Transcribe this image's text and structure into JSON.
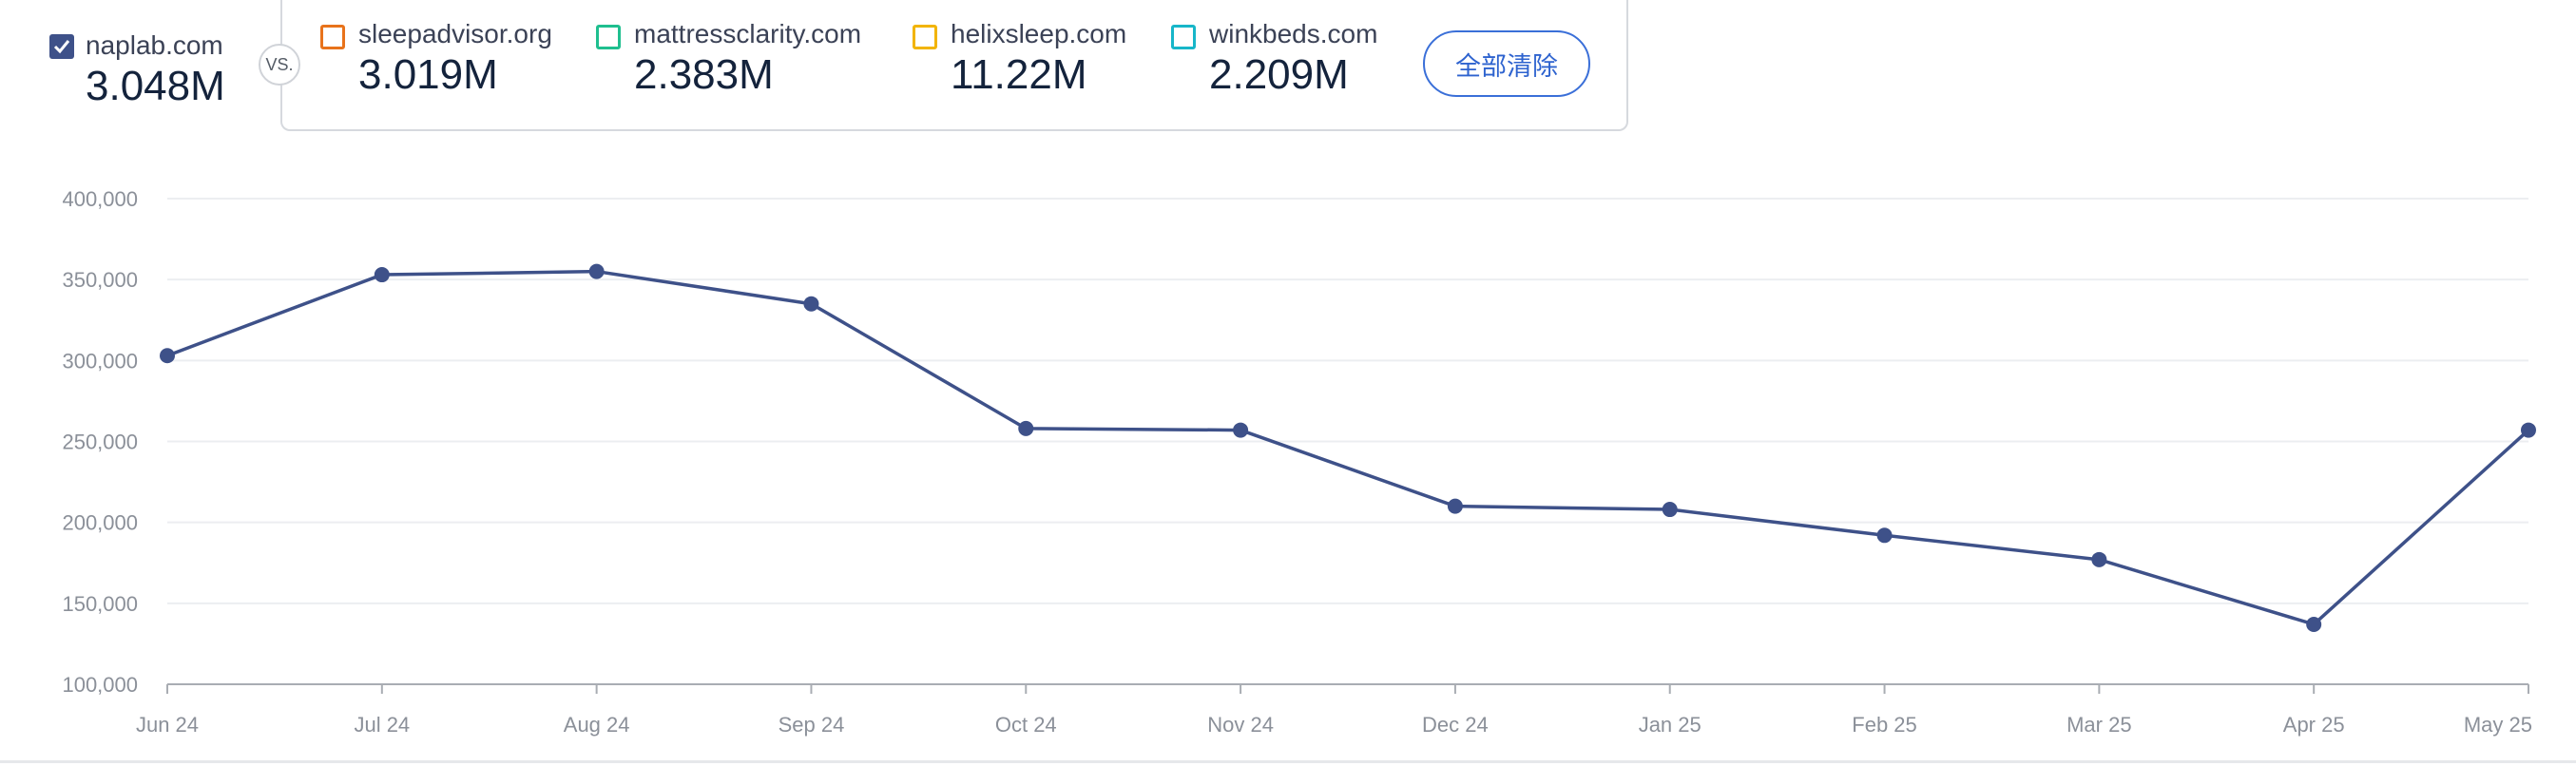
{
  "primary": {
    "domain": "naplab.com",
    "value": "3.048M",
    "checked": true,
    "color": "#3e5189"
  },
  "vs_label": "VS.",
  "competitors": [
    {
      "domain": "sleepadvisor.org",
      "value": "3.019M",
      "color": "#e8731b",
      "checked": false
    },
    {
      "domain": "mattressclarity.com",
      "value": "2.383M",
      "color": "#1fbf8f",
      "checked": false
    },
    {
      "domain": "helixsleep.com",
      "value": "11.22M",
      "color": "#f2b400",
      "checked": false
    },
    {
      "domain": "winkbeds.com",
      "value": "2.209M",
      "color": "#17b6c9",
      "checked": false
    }
  ],
  "clear_button_label": "全部清除",
  "chart_data": {
    "type": "line",
    "categories": [
      "Jun 24",
      "Jul 24",
      "Aug 24",
      "Sep 24",
      "Oct 24",
      "Nov 24",
      "Dec 24",
      "Jan 25",
      "Feb 25",
      "Mar 25",
      "Apr 25",
      "May 25"
    ],
    "series": [
      {
        "name": "naplab.com",
        "color": "#3e5189",
        "values": [
          303000,
          353000,
          355000,
          335000,
          258000,
          257000,
          210000,
          208000,
          192000,
          177000,
          137000,
          257000
        ]
      }
    ],
    "y_ticks": [
      "400,000",
      "350,000",
      "300,000",
      "250,000",
      "200,000",
      "150,000",
      "100,000"
    ],
    "ylim": [
      100000,
      400000
    ],
    "grid": true,
    "title": "",
    "xlabel": "",
    "ylabel": ""
  }
}
